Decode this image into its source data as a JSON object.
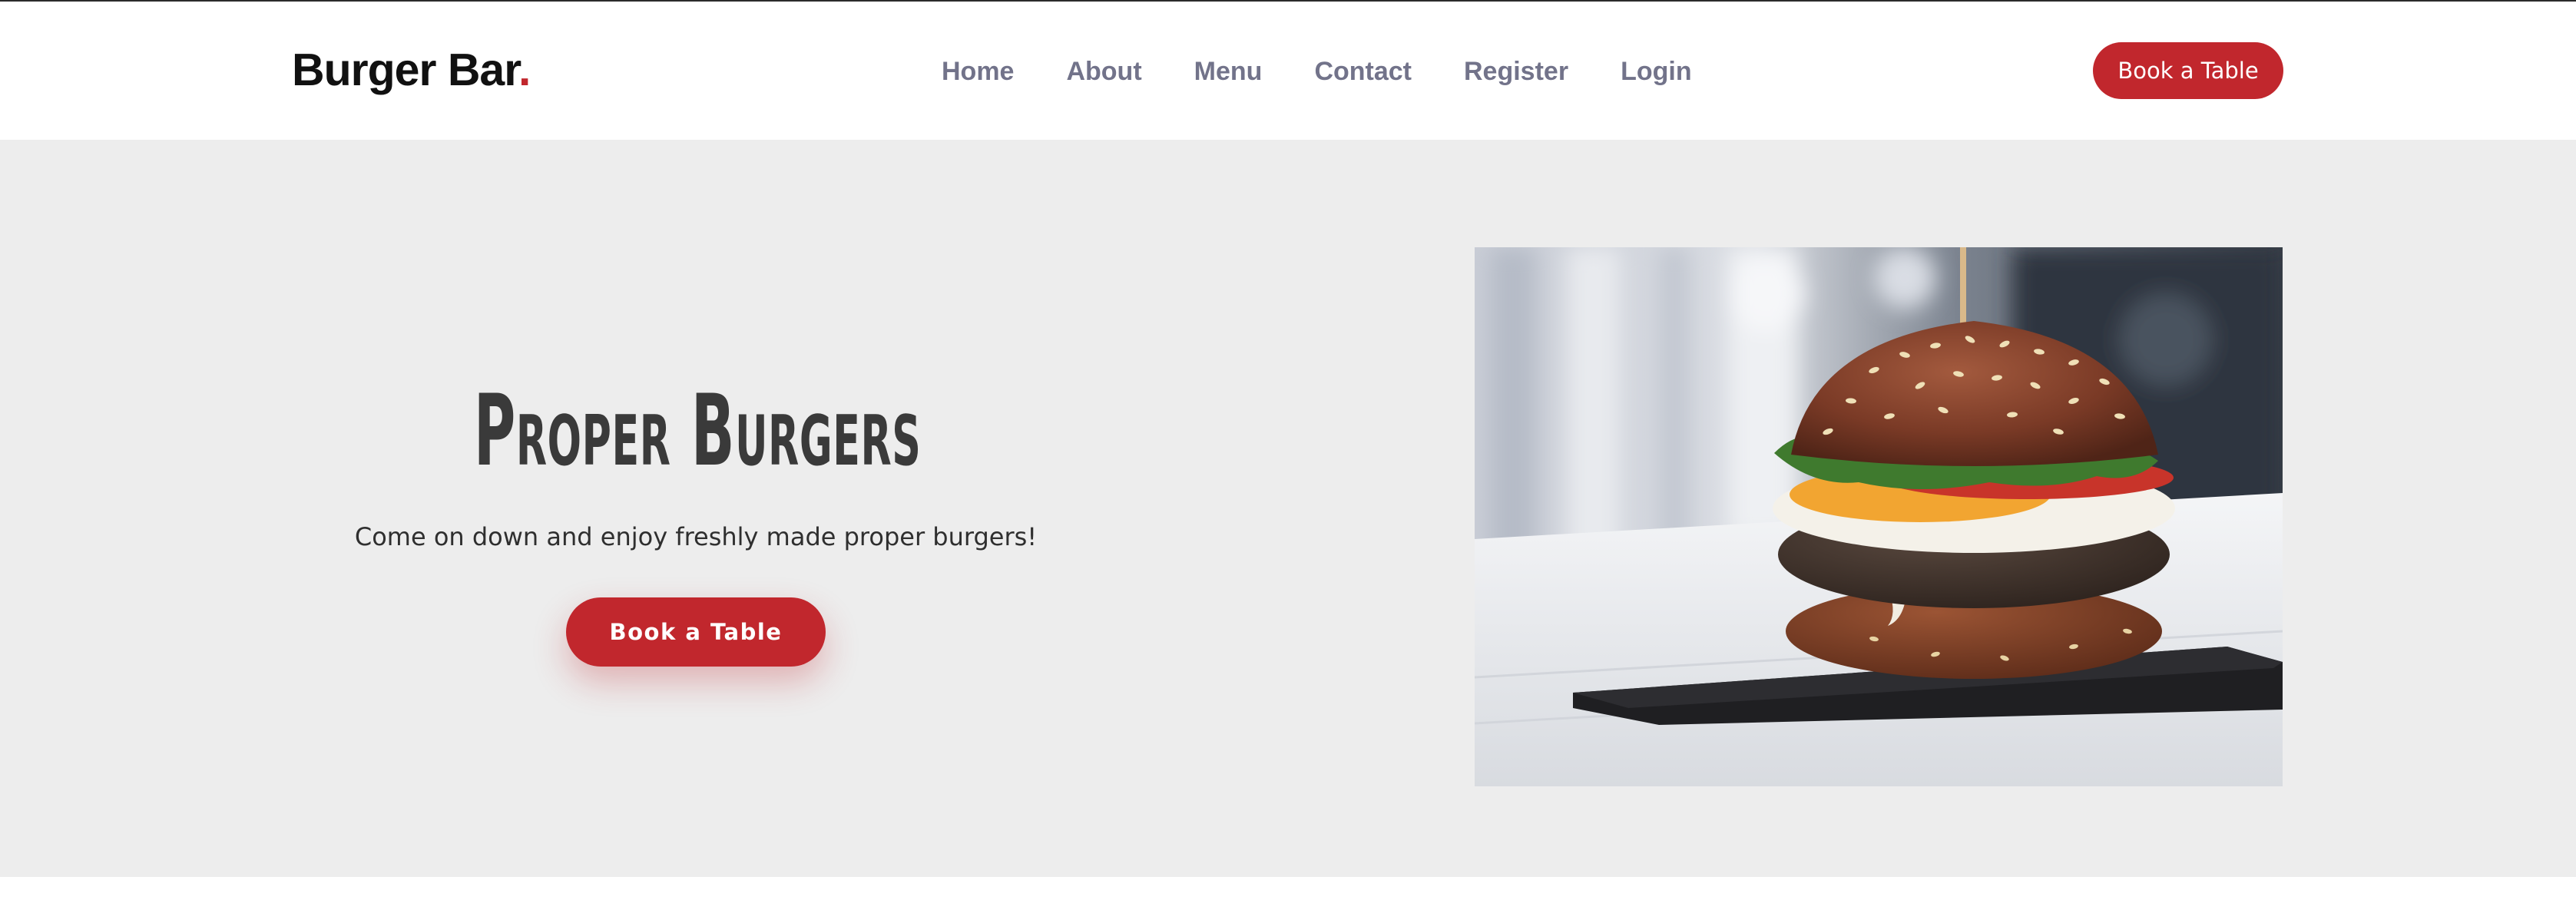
{
  "brand": {
    "name": "Burger Bar",
    "dot": ".",
    "accent_color": "#c1272d"
  },
  "nav": {
    "items": [
      {
        "label": "Home"
      },
      {
        "label": "About"
      },
      {
        "label": "Menu"
      },
      {
        "label": "Contact"
      },
      {
        "label": "Register"
      },
      {
        "label": "Login"
      }
    ]
  },
  "header": {
    "cta_label": "Book a Table"
  },
  "hero": {
    "title": "Proper Burgers",
    "subtitle": "Come on down and enjoy freshly made proper burgers!",
    "cta_label": "Book a Table",
    "background_color": "#ededed",
    "image_icon": "burger-photo"
  }
}
